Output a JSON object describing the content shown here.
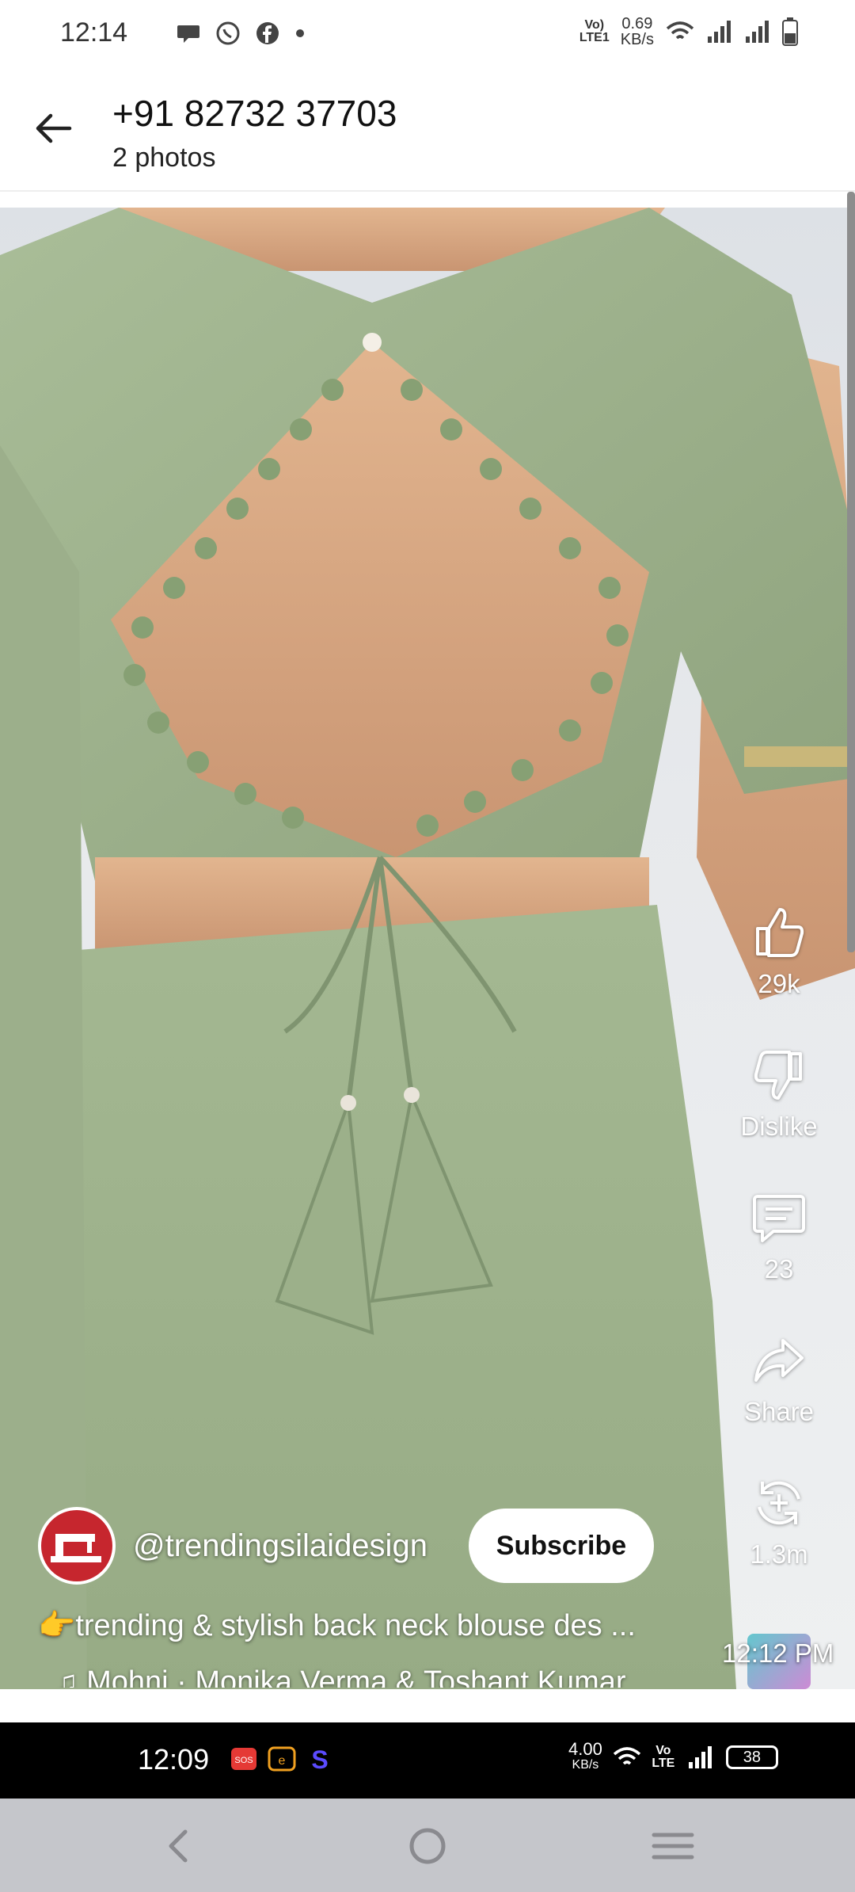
{
  "status_bar": {
    "time": "12:14",
    "network_label_top": "Vo)",
    "network_label_bottom": "LTE1",
    "speed_value": "0.69",
    "speed_unit": "KB/s"
  },
  "header": {
    "title": "+91 82732 37703",
    "subtitle": "2 photos"
  },
  "video": {
    "actions": {
      "like_count": "29k",
      "dislike_label": "Dislike",
      "comment_count": "23",
      "share_label": "Share",
      "remix_count": "1.3m"
    },
    "channel_handle": "@trendingsilaidesign",
    "subscribe_label": "Subscribe",
    "caption": "👉trending & stylish back neck blouse des ...",
    "music": "Mohni · Monika Verma & Toshant Kumar",
    "message_time": "12:12 PM"
  },
  "inner_status": {
    "time": "12:09",
    "speed_value": "4.00",
    "speed_unit": "KB/s",
    "network_label": "Vo LTE",
    "battery": "38"
  },
  "colors": {
    "blouse_green": "#9bb08a",
    "subscribe_bg": "#ffffff",
    "navbar_bg": "#c5c6cb"
  }
}
